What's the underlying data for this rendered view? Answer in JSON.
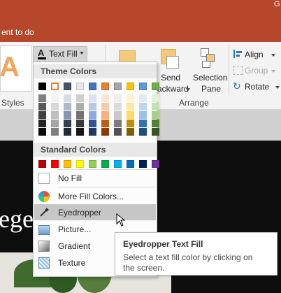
{
  "title_bar": {
    "right_text": "G"
  },
  "tell_me": {
    "text": "ent to do"
  },
  "ribbon": {
    "text_fill_label": "Text Fill",
    "styles_label": "Styles",
    "send_backward": {
      "line1": "Send",
      "line2": "ackward"
    },
    "selection_pane": {
      "line1": "Selection",
      "line2": "Pane"
    },
    "align_label": "Align",
    "group_label": "Group",
    "rotate_label": "Rotate",
    "arrange_label": "Arrange"
  },
  "menu": {
    "theme_colors_header": "Theme Colors",
    "standard_colors_header": "Standard Colors",
    "theme_top": [
      "#000000",
      "#ffffff",
      "#44546a",
      "#e7e6e6",
      "#4472c4",
      "#ed7d31",
      "#a5a5a5",
      "#ffc000",
      "#5b9bd5",
      "#70ad47"
    ],
    "theme_shades": [
      [
        "#7f7f7f",
        "#595959",
        "#3f3f3f",
        "#262626",
        "#0c0c0c"
      ],
      [
        "#f2f2f2",
        "#d8d8d8",
        "#bfbfbf",
        "#a5a5a5",
        "#7f7f7f"
      ],
      [
        "#d6dce4",
        "#adb9ca",
        "#8497b0",
        "#333f4f",
        "#222a35"
      ],
      [
        "#d0cece",
        "#aeabab",
        "#757171",
        "#3a3838",
        "#171616"
      ],
      [
        "#d9e2f3",
        "#b4c7e7",
        "#8faadc",
        "#2f5597",
        "#1f3864"
      ],
      [
        "#fbe5d5",
        "#f8cbad",
        "#f4b183",
        "#c55a11",
        "#833c0b"
      ],
      [
        "#ededed",
        "#dbdbdb",
        "#c9c9c9",
        "#7b7b7b",
        "#525252"
      ],
      [
        "#fff2cc",
        "#ffe699",
        "#ffd966",
        "#bf9000",
        "#7f6000"
      ],
      [
        "#deebf6",
        "#bdd7ee",
        "#9dc3e6",
        "#2e75b5",
        "#1e4e79"
      ],
      [
        "#e2efd9",
        "#c5e0b3",
        "#a8d08d",
        "#538135",
        "#375623"
      ]
    ],
    "standard_colors": [
      "#c00000",
      "#ff0000",
      "#ffc000",
      "#ffff00",
      "#92d050",
      "#00b050",
      "#00b0f0",
      "#0070c0",
      "#002060",
      "#7030a0"
    ],
    "no_fill": "No Fill",
    "more_fill_colors": "More Fill Colors...",
    "eyedropper": "Eyedropper",
    "picture": "Picture...",
    "gradient": "Gradient",
    "texture": "Texture"
  },
  "slide": {
    "visible_text": "ege"
  },
  "tooltip": {
    "title": "Eyedropper Text Fill",
    "line1": "Select a text fill color by clicking on",
    "line2": "the screen."
  }
}
